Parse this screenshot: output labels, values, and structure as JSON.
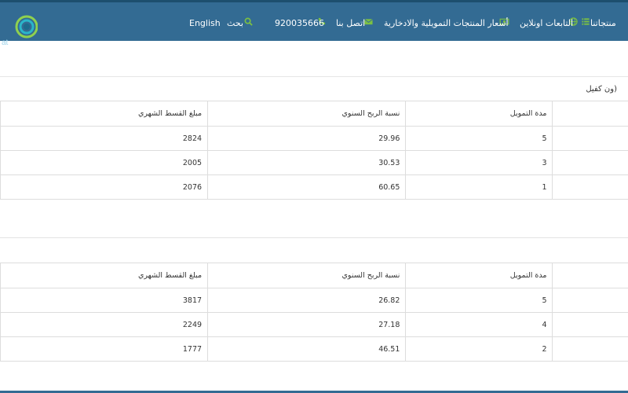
{
  "nav": {
    "brand_fragment": "at",
    "english": "English",
    "search": "بحث",
    "phone": "920035666",
    "contact": "اتصل بنا",
    "prices": "أسعار المنتجات التمويلية والادخارية",
    "online": "التابعات اونلاين",
    "products": "منتجاتنا"
  },
  "section1": {
    "title": "ون كفيل)",
    "headers": [
      "مدة التمويل",
      "نسبة الربح السنوي",
      "مبلغ القسط الشهري"
    ],
    "rows": [
      [
        "5",
        "29.96",
        "2824"
      ],
      [
        "3",
        "30.53",
        "2005"
      ],
      [
        "1",
        "60.65",
        "2076"
      ]
    ]
  },
  "section2": {
    "headers": [
      "مدة التمويل",
      "نسبة الربح السنوي",
      "مبلغ القسط الشهري"
    ],
    "rows": [
      [
        "5",
        "26.82",
        "3817"
      ],
      [
        "4",
        "27.18",
        "2249"
      ],
      [
        "2",
        "46.51",
        "1777"
      ]
    ]
  },
  "colors": {
    "navbar": "#336b93",
    "accent_icon": "#7bc043"
  },
  "icons": [
    "logo-icon",
    "search-icon",
    "phone-icon",
    "mail-icon",
    "money-icon",
    "globe-icon",
    "list-icon"
  ]
}
